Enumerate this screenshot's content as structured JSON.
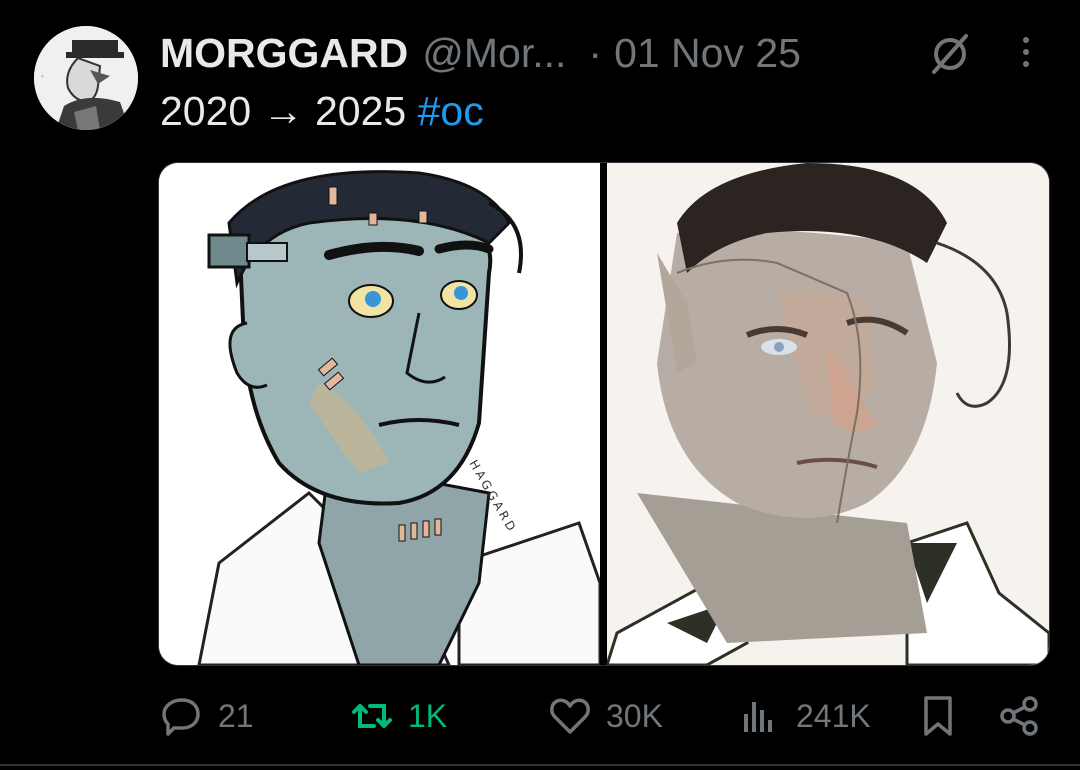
{
  "post": {
    "author_name": "MORGGARD",
    "author_handle": "@Mor...",
    "separator": "·",
    "date": "01 Nov 25",
    "text_main": "2020 → 2025 ",
    "hashtag": "#oc",
    "avatar_icon": "avatar-top-hat-figure",
    "image_left_signature": "HAGGARD"
  },
  "actions": {
    "replies": "21",
    "reposts": "1K",
    "likes": "30K",
    "views": "241K"
  },
  "colors": {
    "background": "#000000",
    "text": "#e7e9ea",
    "muted": "#71767b",
    "link": "#1d9bf0",
    "repost": "#00ba7c"
  }
}
